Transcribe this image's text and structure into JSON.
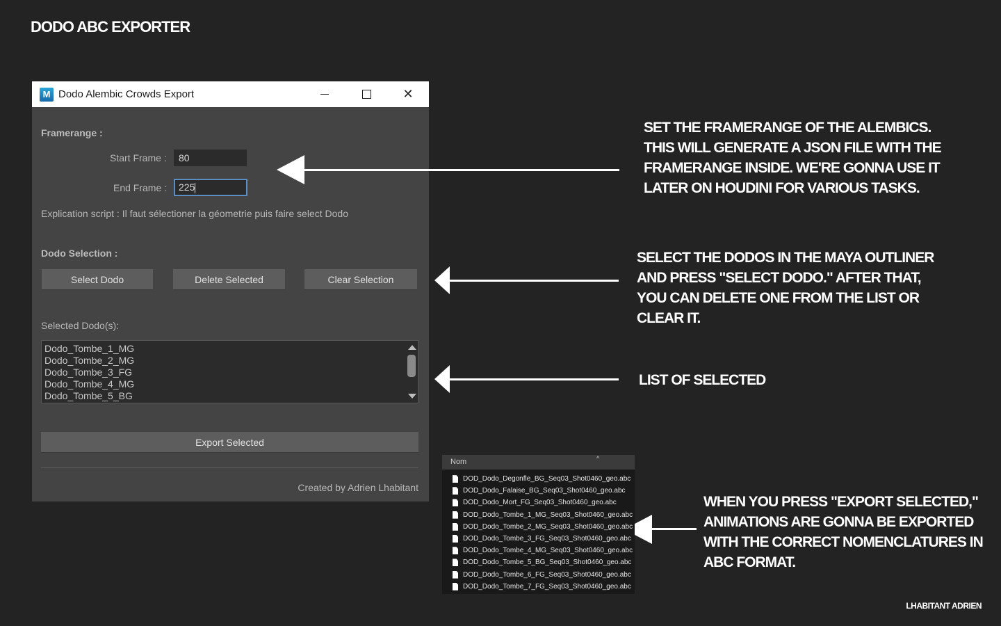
{
  "page": {
    "title": "DODO ABC EXPORTER",
    "signature": "LHABITANT ADRIEN"
  },
  "window": {
    "icon_letter": "M",
    "title": "Dodo Alembic Crowds Export",
    "controls": [
      "minimize",
      "maximize",
      "close"
    ],
    "close_glyph": "✕"
  },
  "framerange": {
    "section_label": "Framerange :",
    "start_label": "Start Frame :",
    "start_value": "80",
    "end_label": "End Frame :",
    "end_value": "225"
  },
  "explication": "Explication script : Il faut sélectioner la géometrie puis faire select Dodo",
  "dodo_selection": {
    "section_label": "Dodo Selection :",
    "buttons": {
      "select": "Select Dodo",
      "delete": "Delete Selected",
      "clear": "Clear Selection"
    }
  },
  "selected": {
    "label": "Selected Dodo(s):",
    "items": [
      "Dodo_Tombe_1_MG",
      "Dodo_Tombe_2_MG",
      "Dodo_Tombe_3_FG",
      "Dodo_Tombe_4_MG",
      "Dodo_Tombe_5_BG"
    ]
  },
  "export": {
    "button": "Export Selected",
    "credit": "Created by Adrien Lhabitant"
  },
  "annotations": {
    "framerange": [
      "SET THE FRAMERANGE OF THE ALEMBICS.",
      "THIS WILL GENERATE A JSON FILE WITH THE",
      "FRAMERANGE INSIDE. WE'RE GONNA USE IT",
      "LATER ON HOUDINI FOR VARIOUS TASKS."
    ],
    "selection": [
      "SELECT THE DODOS IN THE MAYA OUTLINER",
      "AND PRESS \"SELECT DODO.\" AFTER THAT,",
      "YOU CAN DELETE ONE FROM THE LIST OR",
      "CLEAR IT."
    ],
    "list": [
      "LIST OF SELECTED"
    ],
    "export": [
      "WHEN YOU PRESS \"EXPORT SELECTED,\"",
      "ANIMATIONS ARE GONNA BE EXPORTED",
      "WITH THE CORRECT NOMENCLATURES IN",
      "ABC FORMAT."
    ]
  },
  "explorer": {
    "column_header": "Nom",
    "sort_glyph": "^",
    "files": [
      "DOD_Dodo_Degonfle_BG_Seq03_Shot0460_geo.abc",
      "DOD_Dodo_Falaise_BG_Seq03_Shot0460_geo.abc",
      "DOD_Dodo_Mort_FG_Seq03_Shot0460_geo.abc",
      "DOD_Dodo_Tombe_1_MG_Seq03_Shot0460_geo.abc",
      "DOD_Dodo_Tombe_2_MG_Seq03_Shot0460_geo.abc",
      "DOD_Dodo_Tombe_3_FG_Seq03_Shot0460_geo.abc",
      "DOD_Dodo_Tombe_4_MG_Seq03_Shot0460_geo.abc",
      "DOD_Dodo_Tombe_5_BG_Seq03_Shot0460_geo.abc",
      "DOD_Dodo_Tombe_6_FG_Seq03_Shot0460_geo.abc",
      "DOD_Dodo_Tombe_7_FG_Seq03_Shot0460_geo.abc"
    ]
  },
  "colors": {
    "background": "#232323",
    "window_body": "#444444",
    "button": "#5d5d5d",
    "focus_border": "#5b8fc4",
    "annotation_text": "#ffffff"
  }
}
